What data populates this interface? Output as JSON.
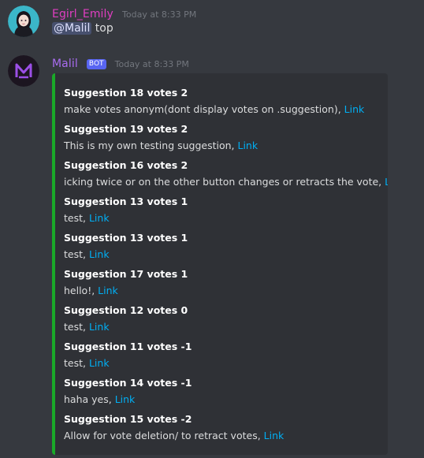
{
  "messages": [
    {
      "username": "Egirl_Emily",
      "username_color": "#e03ec1",
      "timestamp": "Today at 8:33 PM",
      "mention": "@Malil",
      "text": "top"
    },
    {
      "username": "Malil",
      "username_color": "#a96cf0",
      "bot_tag": "BOT",
      "timestamp": "Today at 8:33 PM"
    }
  ],
  "embed": {
    "accent_color": "#1aa928",
    "link_label": "Link",
    "fields": [
      {
        "name": "Suggestion 18 votes 2",
        "value": "make votes anonym(dont display votes on .suggestion), "
      },
      {
        "name": "Suggestion 19 votes 2",
        "value": "This is my own testing suggestion, "
      },
      {
        "name": "Suggestion 16 votes 2",
        "value": "icking twice or on the other button changes or retracts the vote, "
      },
      {
        "name": "Suggestion 13 votes 1",
        "value": "test, "
      },
      {
        "name": "Suggestion 13 votes 1",
        "value": "test, "
      },
      {
        "name": "Suggestion 17 votes 1",
        "value": "hello!, "
      },
      {
        "name": "Suggestion 12 votes 0",
        "value": "test, "
      },
      {
        "name": "Suggestion 11 votes -1",
        "value": "test, "
      },
      {
        "name": "Suggestion 14 votes -1",
        "value": "haha yes, "
      },
      {
        "name": "Suggestion 15 votes -2",
        "value": "Allow for vote deletion/ to retract votes, "
      }
    ]
  }
}
